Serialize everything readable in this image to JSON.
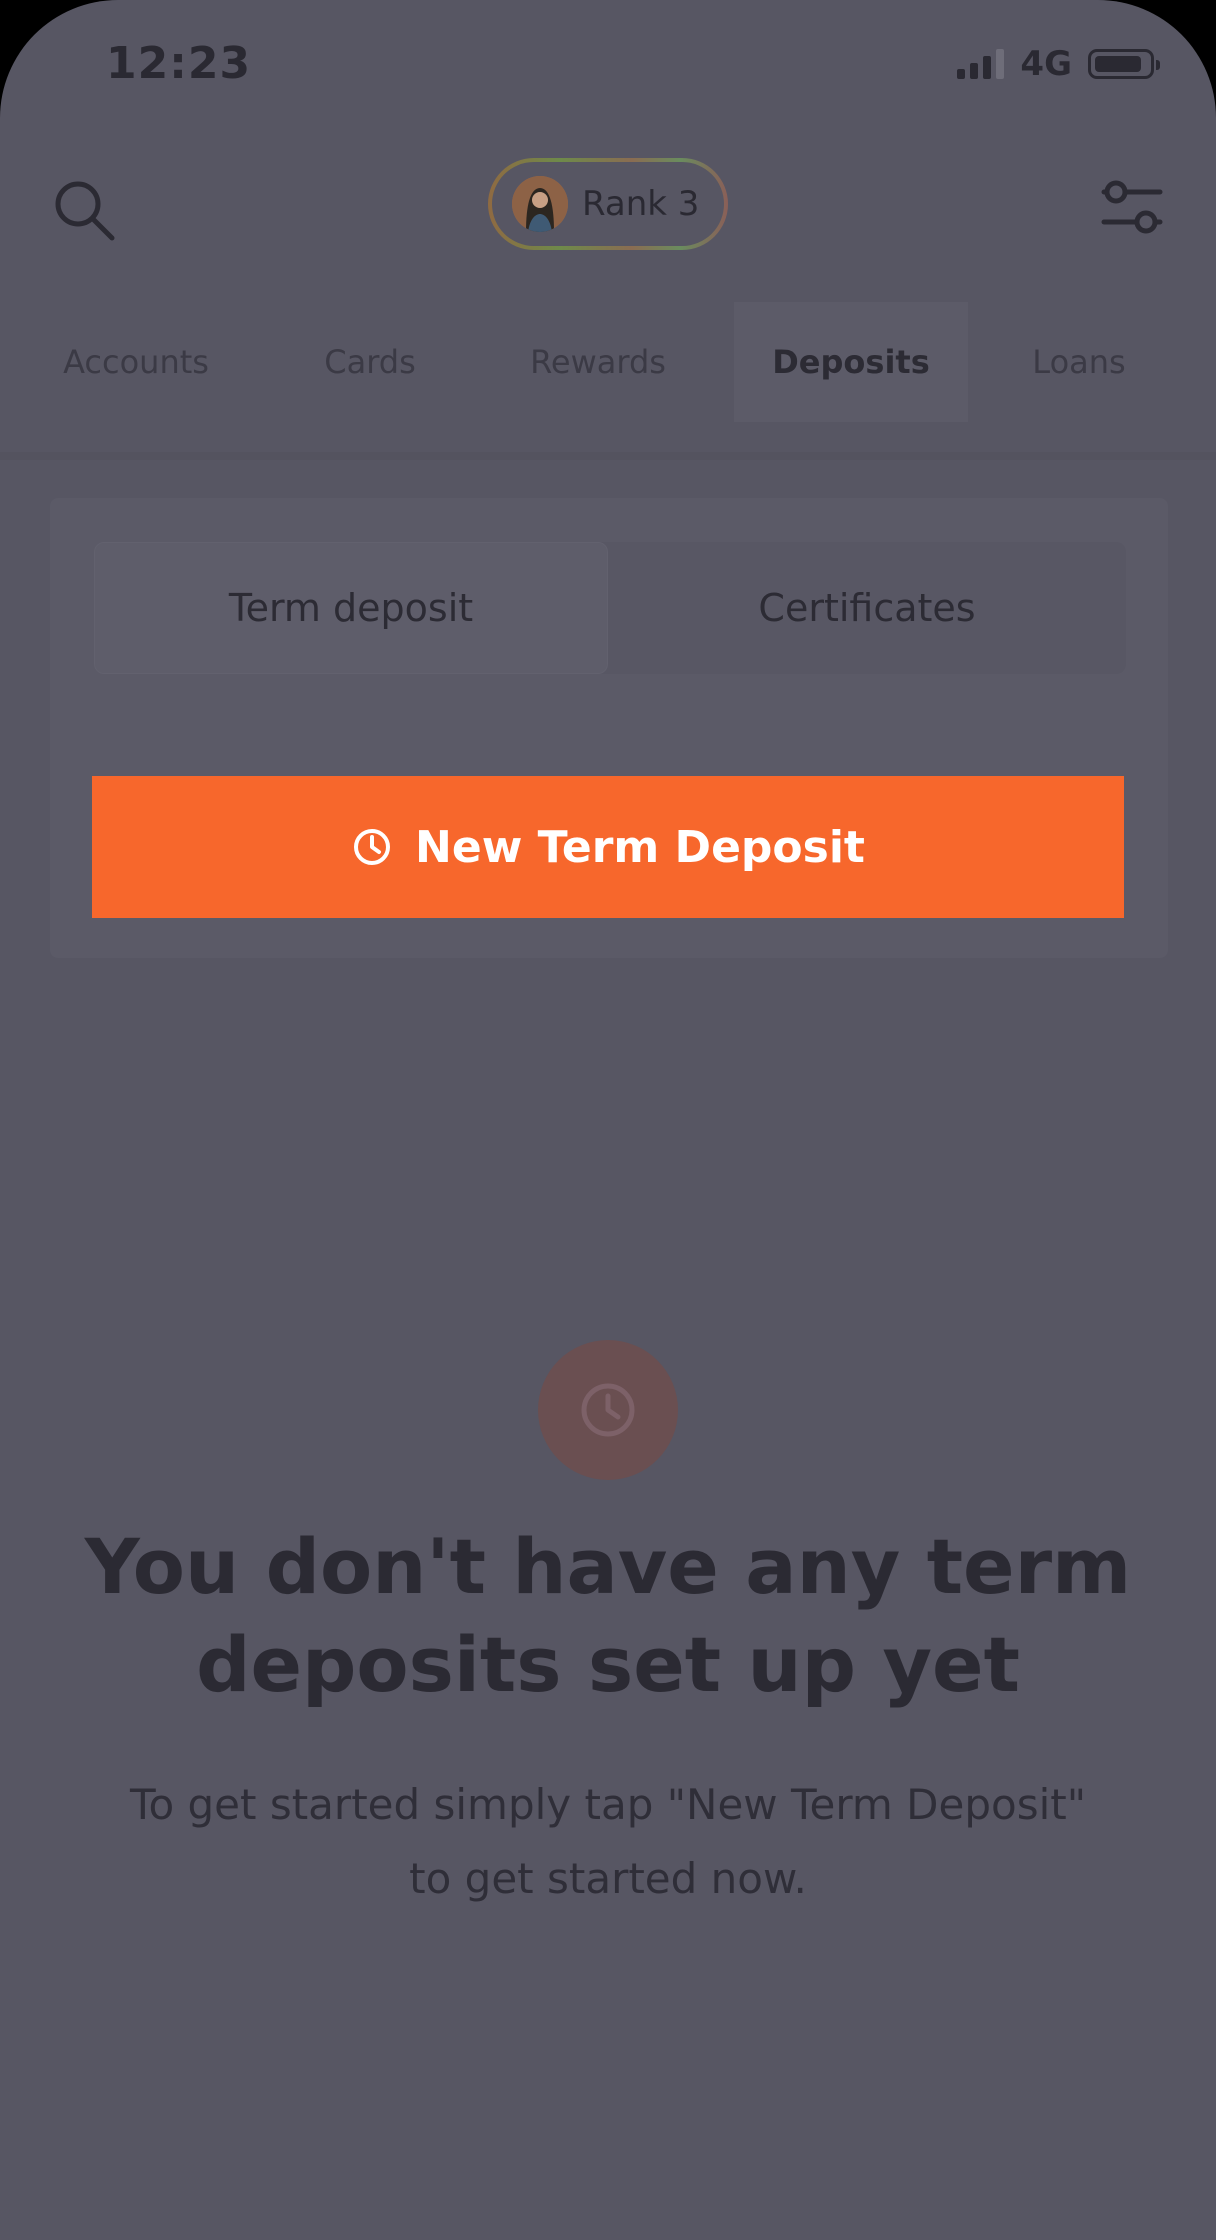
{
  "status_bar": {
    "time": "12:23",
    "network": "4G"
  },
  "header": {
    "rank_label": "Rank 3"
  },
  "tabs": [
    {
      "label": "Accounts",
      "active": false
    },
    {
      "label": "Cards",
      "active": false
    },
    {
      "label": "Rewards",
      "active": false
    },
    {
      "label": "Deposits",
      "active": true
    },
    {
      "label": "Loans",
      "active": false
    }
  ],
  "segment": {
    "items": [
      {
        "label": "Term deposit",
        "active": true
      },
      {
        "label": "Certificates",
        "active": false
      }
    ]
  },
  "new_button": {
    "label": "New Term Deposit"
  },
  "empty_state": {
    "title_line1": "You don't have any term",
    "title_line2": "deposits set up yet",
    "desc_line1": "To get started simply tap \"New Term Deposit\"",
    "desc_line2": "to get started now."
  },
  "colors": {
    "accent": "#f7672c",
    "background": "#575663",
    "text_dark": "#2b2a33"
  },
  "icons": {
    "search": "search-icon",
    "filter": "filter-sliders-icon",
    "avatar": "avatar",
    "clock": "clock-icon"
  }
}
